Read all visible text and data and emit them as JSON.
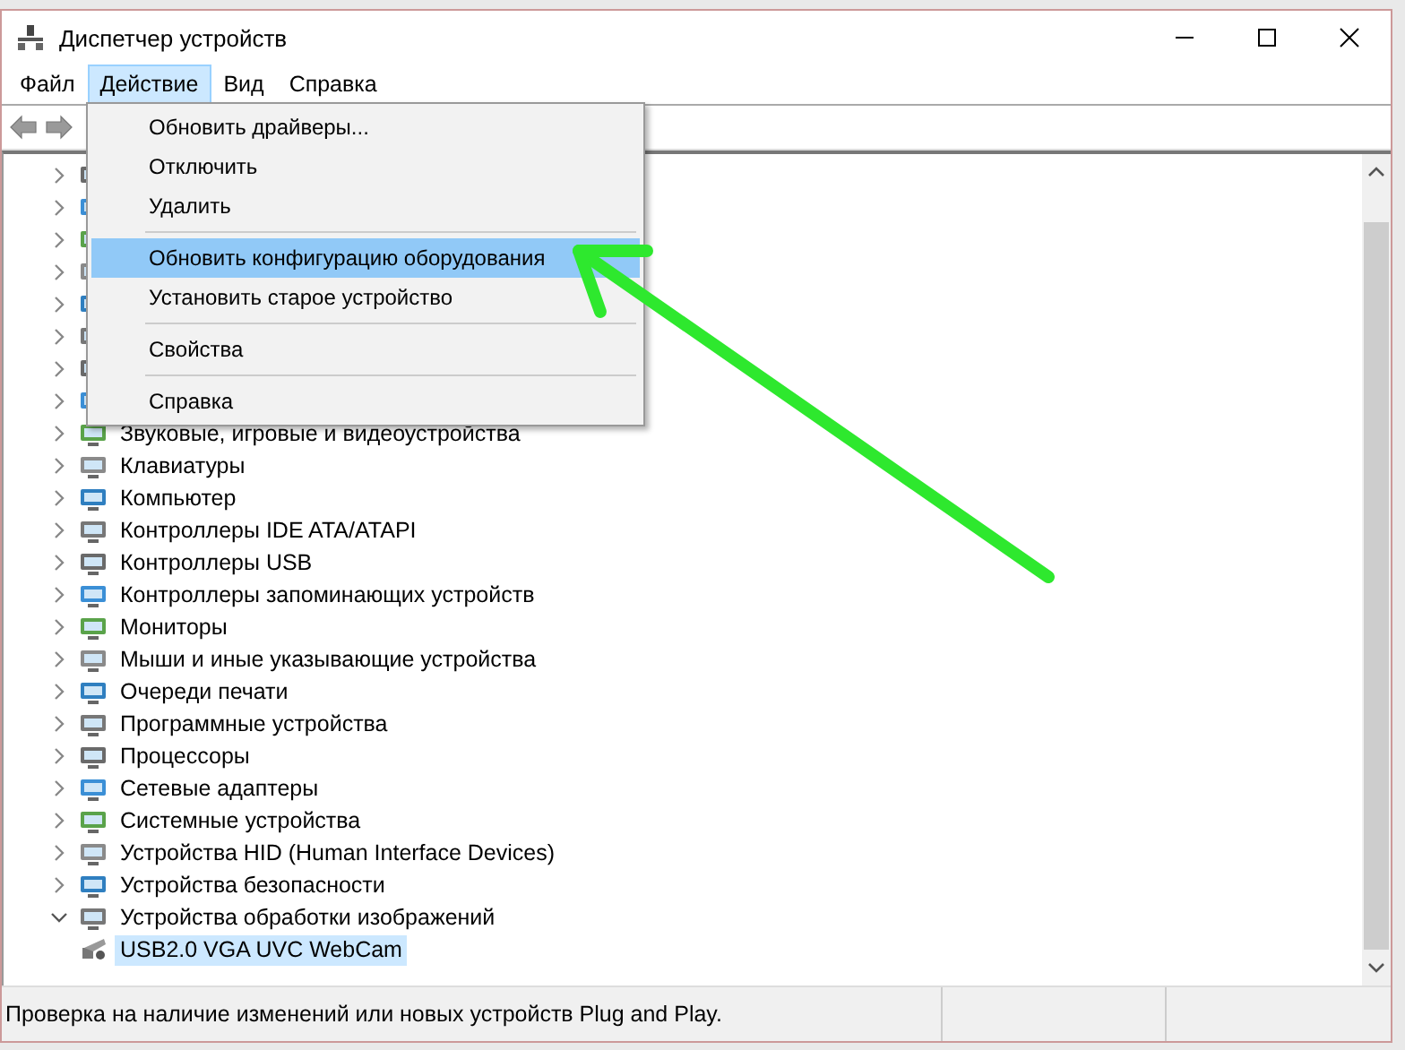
{
  "window": {
    "title": "Диспетчер устройств"
  },
  "menu_bar": [
    {
      "label": "Файл",
      "selected": false
    },
    {
      "label": "Действие",
      "selected": true
    },
    {
      "label": "Вид",
      "selected": false
    },
    {
      "label": "Справка",
      "selected": false
    }
  ],
  "action_menu": [
    {
      "kind": "item",
      "label": "Обновить драйверы...",
      "selected": false
    },
    {
      "kind": "item",
      "label": "Отключить",
      "selected": false
    },
    {
      "kind": "item",
      "label": "Удалить",
      "selected": false
    },
    {
      "kind": "separator"
    },
    {
      "kind": "item",
      "label": "Обновить конфигурацию оборудования",
      "selected": true
    },
    {
      "kind": "item",
      "label": "Установить старое устройство",
      "selected": false
    },
    {
      "kind": "separator"
    },
    {
      "kind": "item",
      "label": "Свойства",
      "selected": false
    },
    {
      "kind": "separator"
    },
    {
      "kind": "item",
      "label": "Справка",
      "selected": false
    }
  ],
  "tree": [
    {
      "expanded": false
    },
    {
      "expanded": false
    },
    {
      "expanded": false
    },
    {
      "expanded": false
    },
    {
      "expanded": false
    },
    {
      "expanded": false
    },
    {
      "expanded": false
    },
    {
      "expanded": false
    },
    {
      "label": "Звуковые, игровые и видеоустройства",
      "expanded": false
    },
    {
      "label": "Клавиатуры",
      "expanded": false
    },
    {
      "label": "Компьютер",
      "expanded": false
    },
    {
      "label": "Контроллеры IDE ATA/ATAPI",
      "expanded": false
    },
    {
      "label": "Контроллеры USB",
      "expanded": false
    },
    {
      "label": "Контроллеры запоминающих устройств",
      "expanded": false
    },
    {
      "label": "Мониторы",
      "expanded": false
    },
    {
      "label": "Мыши и иные указывающие устройства",
      "expanded": false
    },
    {
      "label": "Очереди печати",
      "expanded": false
    },
    {
      "label": "Программные устройства",
      "expanded": false
    },
    {
      "label": "Процессоры",
      "expanded": false
    },
    {
      "label": "Сетевые адаптеры",
      "expanded": false
    },
    {
      "label": "Системные устройства",
      "expanded": false
    },
    {
      "label": "Устройства HID (Human Interface Devices)",
      "expanded": false
    },
    {
      "label": "Устройства безопасности",
      "expanded": false
    },
    {
      "label": "Устройства обработки изображений",
      "expanded": true,
      "children": [
        {
          "label": "USB2.0 VGA UVC WebCam",
          "selected": true
        }
      ]
    }
  ],
  "status_bar": {
    "text": "Проверка на наличие изменений или новых устройств Plug and Play."
  }
}
